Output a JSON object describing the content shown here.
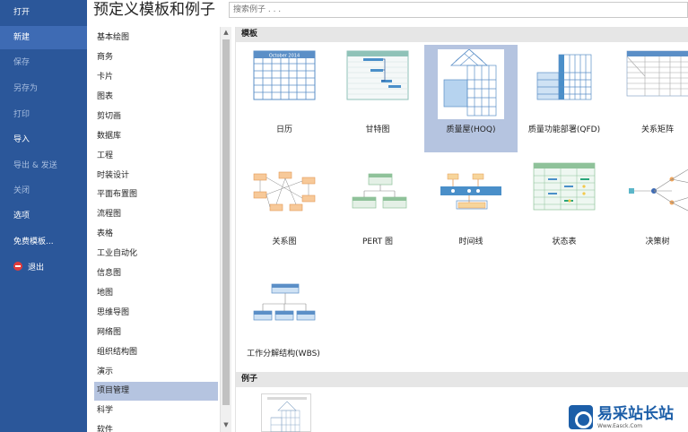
{
  "nav": {
    "open": "打开",
    "new": "新建",
    "save": "保存",
    "save_as": "另存为",
    "print": "打印",
    "import": "导入",
    "export_send": "导出 & 发送",
    "close": "关闭",
    "options": "选项",
    "free_templates": "免费模板...",
    "exit": "退出"
  },
  "header": {
    "title": "预定义模板和例子",
    "search_placeholder": "搜索例子 . . ."
  },
  "categories": [
    "基本绘图",
    "商务",
    "卡片",
    "图表",
    "剪切画",
    "数据库",
    "工程",
    "时装设计",
    "平面布置图",
    "流程图",
    "表格",
    "工业自动化",
    "信息图",
    "地图",
    "思维导图",
    "网络图",
    "组织结构图",
    "演示",
    "项目管理",
    "科学",
    "软件"
  ],
  "selected_category": "项目管理",
  "sections": {
    "templates": "模板",
    "examples": "例子"
  },
  "templates": [
    {
      "label": "日历",
      "icon": "calendar-thumbnail",
      "calendar_title": "October 2014"
    },
    {
      "label": "甘特图",
      "icon": "gantt-thumbnail"
    },
    {
      "label": "质量屋(HOQ)",
      "icon": "house-of-quality-thumbnail",
      "selected": true
    },
    {
      "label": "质量功能部署(QFD)",
      "icon": "qfd-thumbnail"
    },
    {
      "label": "关系矩阵",
      "icon": "relation-matrix-thumbnail"
    },
    {
      "label": "关系图",
      "icon": "relation-diagram-thumbnail"
    },
    {
      "label": "PERT 图",
      "icon": "pert-thumbnail"
    },
    {
      "label": "时间线",
      "icon": "timeline-thumbnail"
    },
    {
      "label": "状态表",
      "icon": "status-table-thumbnail"
    },
    {
      "label": "决策树",
      "icon": "decision-tree-thumbnail"
    },
    {
      "label": "工作分解结构(WBS)",
      "icon": "wbs-thumbnail"
    }
  ],
  "watermark": {
    "text": "易采站长站",
    "sub": "Www.Easck.Com"
  },
  "colors": {
    "nav_bg": "#2b579a",
    "nav_active": "#3e6bb4",
    "selection": "#b5c4e0",
    "accent_blue": "#5b8fc7",
    "accent_orange": "#f2a65a",
    "accent_green": "#8fc29a"
  }
}
